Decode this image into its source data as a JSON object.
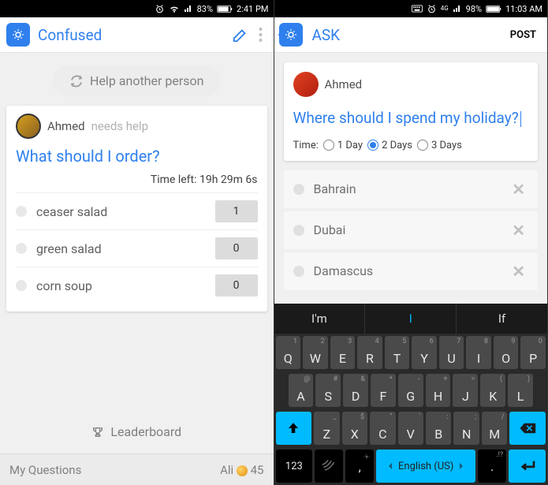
{
  "left": {
    "status": {
      "battery": "83%",
      "time": "2:41 PM"
    },
    "header": {
      "title": "Confused"
    },
    "help_button": "Help another person",
    "card": {
      "username": "Ahmed",
      "needs_help": "needs help",
      "question": "What should I order?",
      "time_left_label": "Time left:",
      "time_left_value": "19h 29m 6s",
      "options": [
        {
          "label": "ceaser salad",
          "votes": "1"
        },
        {
          "label": "green salad",
          "votes": "0"
        },
        {
          "label": "corn soup",
          "votes": "0"
        }
      ]
    },
    "leaderboard": "Leaderboard",
    "bottom": {
      "my_questions": "My Questions",
      "user": "Ali",
      "coins": "45"
    }
  },
  "right": {
    "status": {
      "net": "4G",
      "battery": "98%",
      "time": "11:03 AM"
    },
    "header": {
      "title": "ASK",
      "post": "POST"
    },
    "card": {
      "username": "Ahmed",
      "question": "Where should I spend my holiday?",
      "time_label": "Time:",
      "durations": [
        {
          "label": "1 Day",
          "selected": false
        },
        {
          "label": "2 Days",
          "selected": true
        },
        {
          "label": "3 Days",
          "selected": false
        }
      ],
      "options": [
        {
          "label": "Bahrain"
        },
        {
          "label": "Dubai"
        },
        {
          "label": "Damascus"
        }
      ]
    },
    "keyboard": {
      "suggestions": [
        "I'm",
        "I",
        "If"
      ],
      "row1": [
        {
          "m": "Q",
          "a": "1"
        },
        {
          "m": "W",
          "a": "2"
        },
        {
          "m": "E",
          "a": "3"
        },
        {
          "m": "R",
          "a": "4"
        },
        {
          "m": "T",
          "a": "5"
        },
        {
          "m": "Y",
          "a": "6"
        },
        {
          "m": "U",
          "a": "7"
        },
        {
          "m": "I",
          "a": "8"
        },
        {
          "m": "O",
          "a": "9"
        },
        {
          "m": "P",
          "a": "0"
        }
      ],
      "row2": [
        {
          "m": "A",
          "a": "@"
        },
        {
          "m": "S",
          "a": "#"
        },
        {
          "m": "D",
          "a": "&"
        },
        {
          "m": "F",
          "a": "*"
        },
        {
          "m": "G",
          "a": "-"
        },
        {
          "m": "H",
          "a": "+"
        },
        {
          "m": "J",
          "a": "="
        },
        {
          "m": "K",
          "a": "("
        },
        {
          "m": "L",
          "a": ")"
        }
      ],
      "row3": [
        {
          "m": "Z",
          "a": "_"
        },
        {
          "m": "X",
          "a": "$"
        },
        {
          "m": "C",
          "a": "\""
        },
        {
          "m": "V",
          "a": "'"
        },
        {
          "m": "B",
          "a": ":"
        },
        {
          "m": "N",
          "a": ";"
        },
        {
          "m": "M",
          "a": "/"
        }
      ],
      "num_key": "123",
      "comma": ",",
      "space": "English (US)",
      "period": ".",
      "period_alt": ".!?"
    }
  }
}
